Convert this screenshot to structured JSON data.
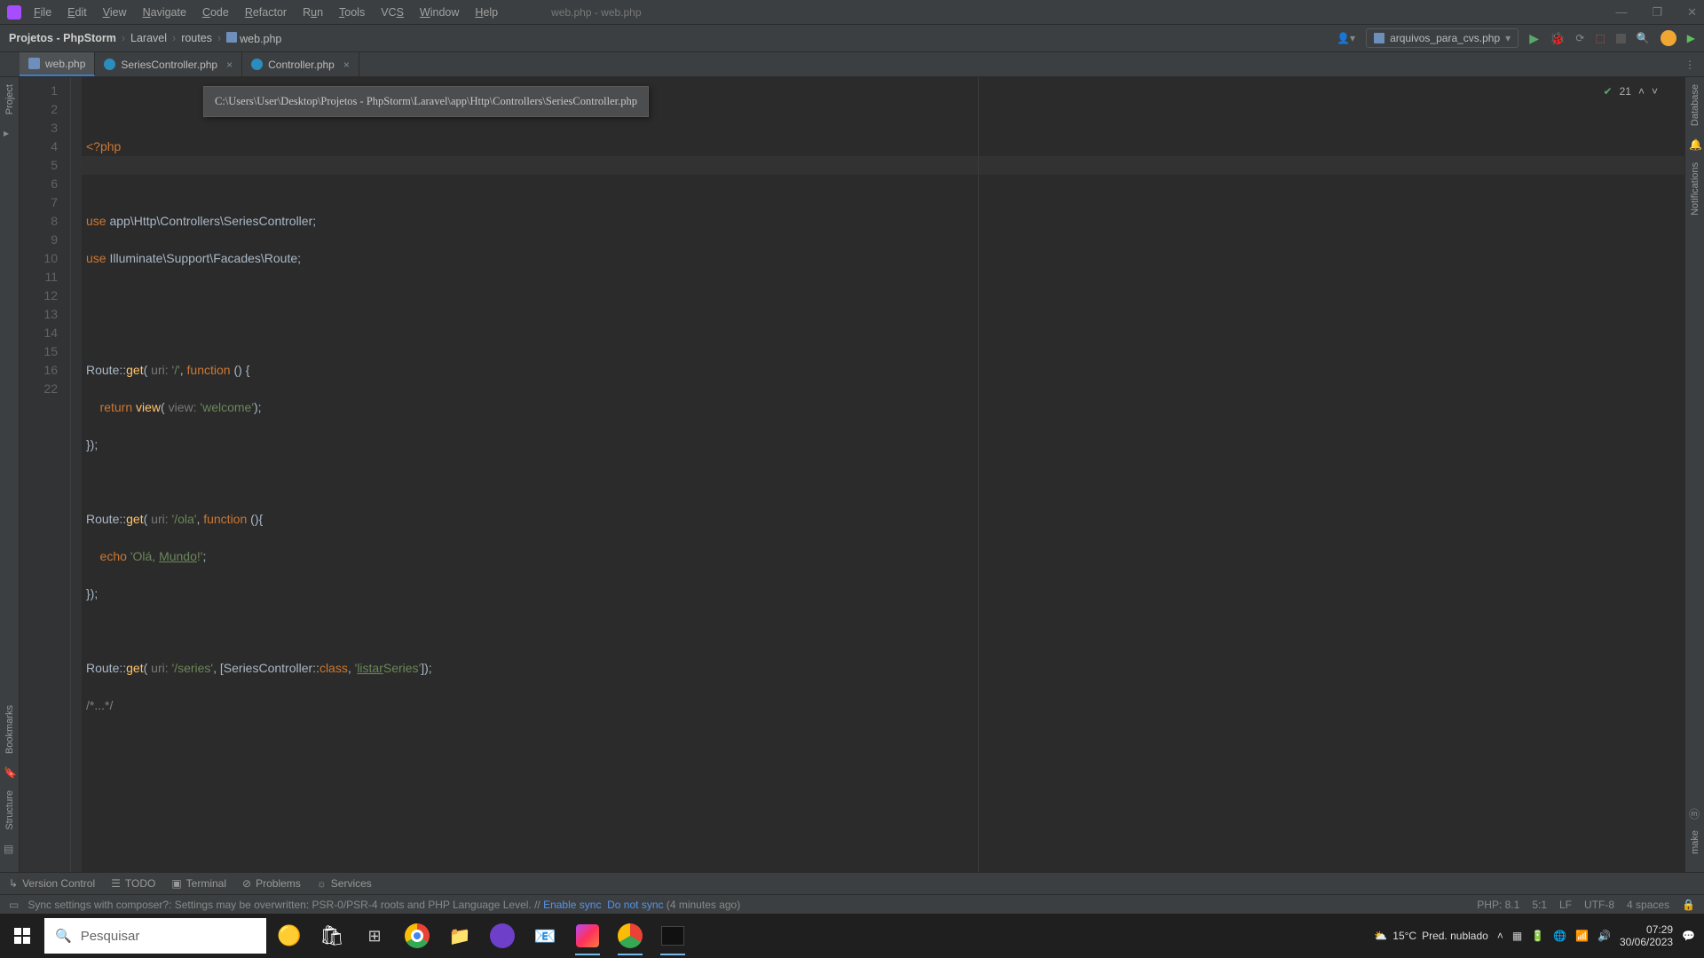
{
  "title": "web.php - web.php",
  "menu": [
    "File",
    "Edit",
    "View",
    "Navigate",
    "Code",
    "Refactor",
    "Run",
    "Tools",
    "VCS",
    "Window",
    "Help"
  ],
  "breadcrumb": {
    "project": "Projetos - PhpStorm",
    "p1": "Laravel",
    "p2": "routes",
    "file": "web.php"
  },
  "runconfig": "arquivos_para_cvs.php",
  "tabs": [
    {
      "name": "web.php",
      "active": true,
      "icon": "php"
    },
    {
      "name": "SeriesController.php",
      "active": false,
      "icon": "cls"
    },
    {
      "name": "Controller.php",
      "active": false,
      "icon": "cls"
    }
  ],
  "tooltip": "C:\\Users\\User\\Desktop\\Projetos - PhpStorm\\Laravel\\app\\Http\\Controllers\\SeriesController.php",
  "insp_count": "21",
  "gutter": [
    "1",
    "2",
    "3",
    "4",
    "5",
    "6",
    "7",
    "8",
    "9",
    "10",
    "11",
    "12",
    "13",
    "14",
    "15",
    "16",
    "22"
  ],
  "code": {
    "l1": "<?php",
    "l3a": "use ",
    "l3b": "app\\Http\\Controllers\\SeriesController",
    "l3c": ";",
    "l4a": "use ",
    "l4b": "Illuminate\\Support\\Facades\\Route",
    "l4c": ";",
    "l7a": "Route",
    "l7b": "::",
    "l7c": "get",
    "l7d": "( ",
    "l7h": "uri: ",
    "l7e": "'/'",
    "l7f": ", ",
    "l7g": "function ",
    "l7i": "() {",
    "l8a": "    return ",
    "l8b": "view",
    "l8c": "( ",
    "l8h": "view: ",
    "l8d": "'welcome'",
    "l8e": ");",
    "l9": "});",
    "l11a": "Route",
    "l11b": "::",
    "l11c": "get",
    "l11d": "( ",
    "l11h": "uri: ",
    "l11e": "'/ola'",
    "l11f": ", ",
    "l11g": "function ",
    "l11i": "(){",
    "l12a": "    echo ",
    "l12b": "'Olá, ",
    "l12c": "Mundo",
    "l12d": "!'",
    "l12e": ";",
    "l13": "});",
    "l15a": "Route",
    "l15b": "::",
    "l15c": "get",
    "l15d": "( ",
    "l15h": "uri: ",
    "l15e": "'/series'",
    "l15f": ", [",
    "l15g": "SeriesController",
    "l15i": "::",
    "l15j": "class",
    "l15k": ", ",
    "l15l": "'",
    "l15m": "listar",
    "l15n": "Series",
    "l15o": "'",
    "l15p": "]);",
    "l16": "/*...*/"
  },
  "sidebars": {
    "left_project": "Project",
    "left_bookmarks": "Bookmarks",
    "left_structure": "Structure",
    "right_db": "Database",
    "right_notif": "Notifications",
    "right_make": "make"
  },
  "bottom": {
    "vc": "Version Control",
    "todo": "TODO",
    "term": "Terminal",
    "prob": "Problems",
    "serv": "Services"
  },
  "status": {
    "sync": "Sync settings with composer?: Settings may be overwritten: PSR-0/PSR-4 roots and PHP Language Level. // ",
    "enable": "Enable sync",
    "nosync": "Do not sync",
    "ago": "(4 minutes ago)",
    "php": "PHP: 8.1",
    "pos": "5:1",
    "lf": "LF",
    "enc": "UTF-8",
    "spaces": "4 spaces"
  },
  "taskbar": {
    "search": "Pesquisar",
    "weather_t": "15°C",
    "weather_d": "Pred. nublado",
    "time": "07:29",
    "date": "30/06/2023"
  }
}
